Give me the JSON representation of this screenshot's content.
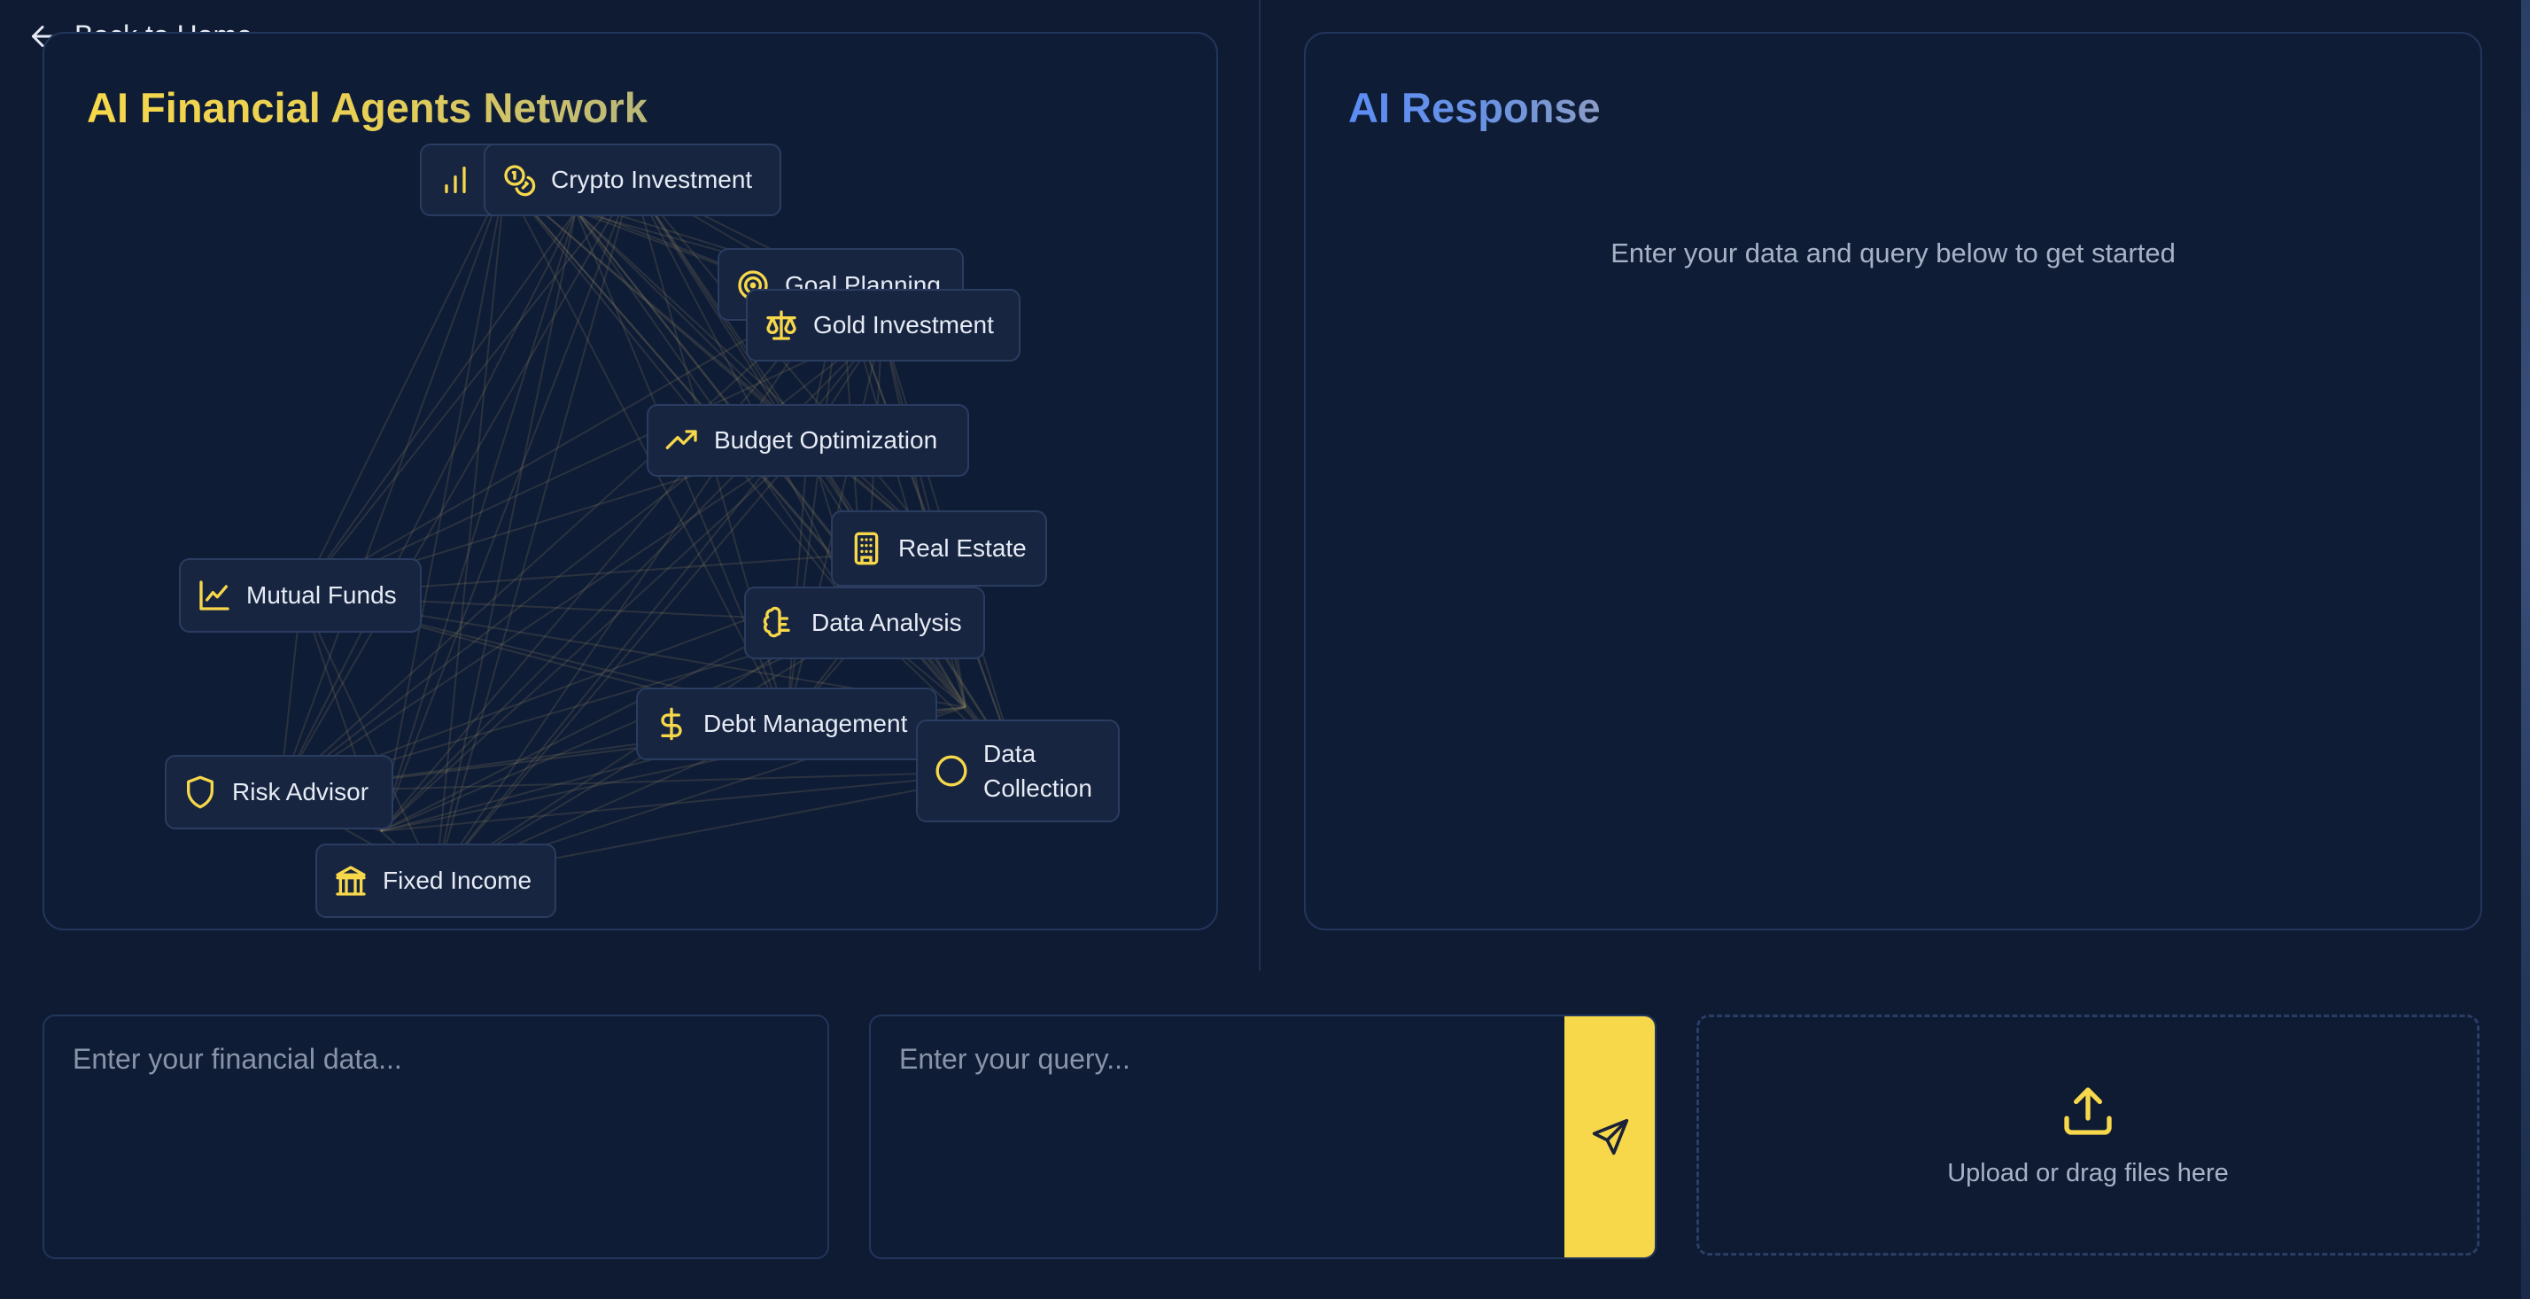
{
  "nav": {
    "back_label": "Back to Home"
  },
  "network": {
    "title": "AI Financial Agents Network",
    "agents": [
      {
        "label": "",
        "icon": "bar-chart-icon"
      },
      {
        "label": "Crypto Investment",
        "icon": "coins-icon"
      },
      {
        "label": "Goal Planning",
        "icon": "target-icon"
      },
      {
        "label": "Gold Investment",
        "icon": "scale-icon"
      },
      {
        "label": "Budget Optimization",
        "icon": "trending-up-icon"
      },
      {
        "label": "Real Estate",
        "icon": "building-icon"
      },
      {
        "label": "Mutual Funds",
        "icon": "line-chart-icon"
      },
      {
        "label": "Data Analysis",
        "icon": "brain-icon"
      },
      {
        "label": "Debt Management",
        "icon": "dollar-sign-icon"
      },
      {
        "label": "Data Collection",
        "icon": "circle-icon"
      },
      {
        "label": "Risk Advisor",
        "icon": "shield-icon"
      },
      {
        "label": "Fixed Income",
        "icon": "bank-icon"
      }
    ]
  },
  "response": {
    "title": "AI Response",
    "empty_message": "Enter your data and query below to get started"
  },
  "inputs": {
    "data_placeholder": "Enter your financial data...",
    "query_placeholder": "Enter your query...",
    "upload_label": "Upload or drag files here"
  },
  "colors": {
    "accent": "#f7d84b",
    "background": "#0f1b33",
    "panel_border": "#22355a",
    "response_title": "#5b8df5"
  }
}
